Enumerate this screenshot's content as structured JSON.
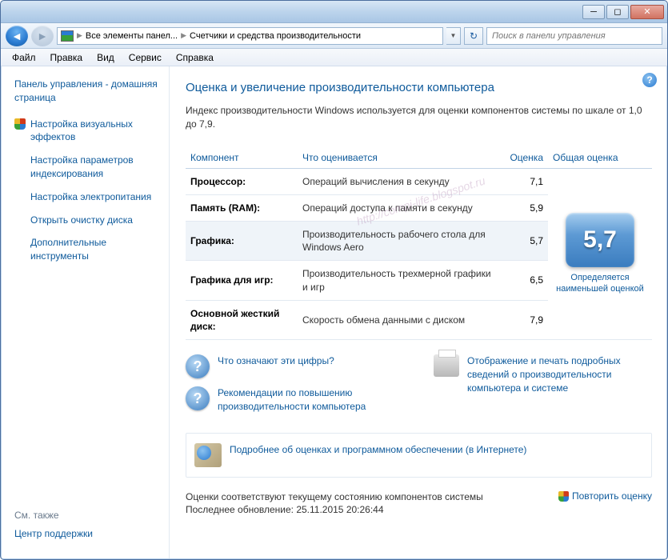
{
  "breadcrumb": {
    "item1": "Все элементы панел...",
    "item2": "Счетчики и средства производительности"
  },
  "search": {
    "placeholder": "Поиск в панели управления"
  },
  "menu": {
    "file": "Файл",
    "edit": "Правка",
    "view": "Вид",
    "tools": "Сервис",
    "help": "Справка"
  },
  "sidebar": {
    "home": "Панель управления - домашняя страница",
    "link1": "Настройка визуальных эффектов",
    "link2": "Настройка параметров индексирования",
    "link3": "Настройка электропитания",
    "link4": "Открыть очистку диска",
    "link5": "Дополнительные инструменты",
    "seealso_hdr": "См. также",
    "seealso1": "Центр поддержки"
  },
  "page": {
    "title": "Оценка и увеличение производительности компьютера",
    "desc": "Индекс производительности Windows используется для оценки компонентов системы по шкале от 1,0 до 7,9.",
    "col1": "Компонент",
    "col2": "Что оценивается",
    "col3": "Оценка",
    "col4": "Общая оценка",
    "rows": [
      {
        "c": "Процессор:",
        "d": "Операций вычисления в секунду",
        "s": "7,1"
      },
      {
        "c": "Память (RAM):",
        "d": "Операций доступа к памяти в секунду",
        "s": "5,9"
      },
      {
        "c": "Графика:",
        "d": "Производительность рабочего стола для Windows Aero",
        "s": "5,7"
      },
      {
        "c": "Графика для игр:",
        "d": "Производительность трехмерной графики и игр",
        "s": "6,5"
      },
      {
        "c": "Основной жесткий диск:",
        "d": "Скорость обмена данными с диском",
        "s": "7,9"
      }
    ],
    "base_score": "5,7",
    "base_sub": "Определяется наименьшей оценкой",
    "q1": "Что означают эти цифры?",
    "q2": "Рекомендации по повышению производительности компьютера",
    "print": "Отображение и печать подробных сведений о производительности компьютера и системе",
    "learn": "Подробнее об оценках и программном обеспечении (в Интернете)",
    "status1": "Оценки соответствуют текущему состоянию компонентов системы",
    "status2": "Последнее обновление: 25.11.2015 20:26:44",
    "rerun": "Повторить оценку"
  },
  "watermark": "http://compi-life.blogspot.ru"
}
